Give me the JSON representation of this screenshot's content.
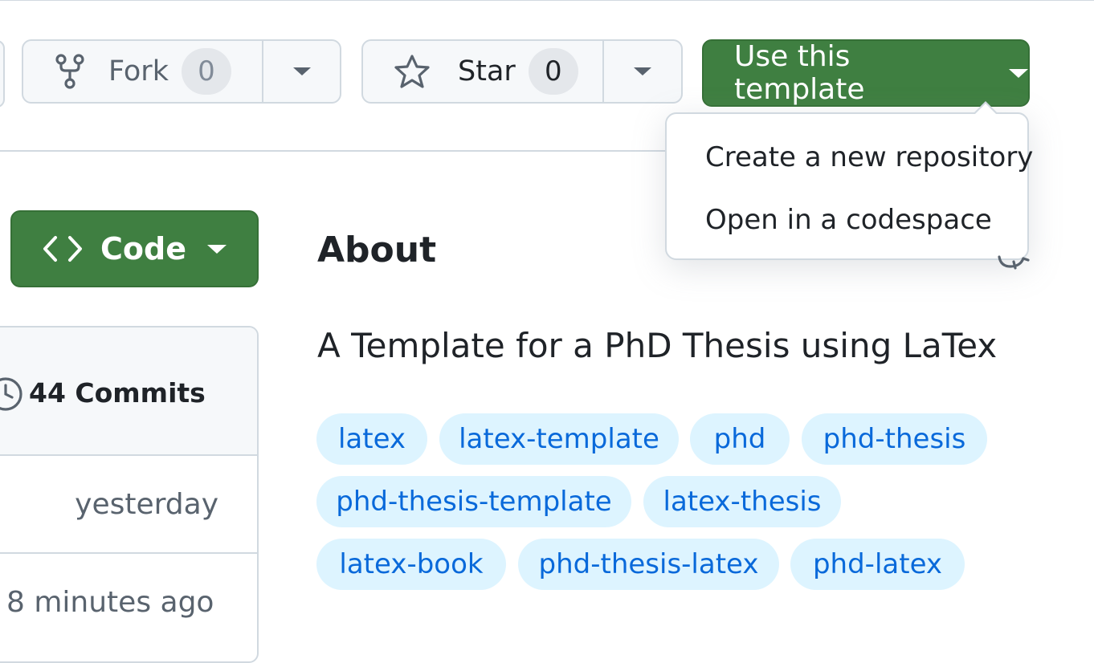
{
  "header": {
    "fork": {
      "label": "Fork",
      "count": "0"
    },
    "star": {
      "label": "Star",
      "count": "0"
    },
    "template_button": {
      "label": "Use this template"
    }
  },
  "template_menu": {
    "items": [
      {
        "label": "Create a new repository"
      },
      {
        "label": "Open in a codespace"
      }
    ]
  },
  "code_button": {
    "label": "Code"
  },
  "file_panel": {
    "commits_label": "44 Commits",
    "rows": [
      {
        "time": "yesterday"
      },
      {
        "time": "8 minutes ago"
      }
    ]
  },
  "about": {
    "title": "About",
    "description": "A Template for a PhD Thesis using LaTex",
    "topics": [
      "latex",
      "latex-template",
      "phd",
      "phd-thesis",
      "phd-thesis-template",
      "latex-thesis",
      "latex-book",
      "phd-thesis-latex",
      "phd-latex"
    ]
  },
  "colors": {
    "primary_green": "#3f7f41",
    "topic_bg": "#ddf4ff",
    "topic_text": "#0969da",
    "border": "#d1d9e0"
  },
  "icons": [
    "repo-forked-icon",
    "star-icon",
    "code-icon",
    "history-icon",
    "gear-icon",
    "triangle-down-icon"
  ]
}
